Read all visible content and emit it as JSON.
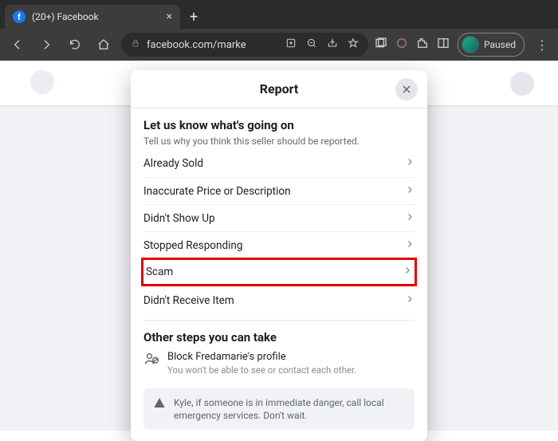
{
  "browser": {
    "tab_title": "(20+) Facebook",
    "url": "facebook.com/marke",
    "paused_label": "Paused"
  },
  "modal": {
    "title": "Report",
    "heading": "Let us know what's going on",
    "subheading": "Tell us why you think this seller should be reported.",
    "options": [
      "Already Sold",
      "Inaccurate Price or Description",
      "Didn't Show Up",
      "Stopped Responding",
      "Scam",
      "Didn't Receive Item"
    ],
    "highlight_index": 4,
    "other_title": "Other steps you can take",
    "block_title": "Block Fredamarie's profile",
    "block_sub": "You won't be able to see or contact each other.",
    "warn_text": "Kyle, if someone is in immediate danger, call local emergency services. Don't wait."
  }
}
